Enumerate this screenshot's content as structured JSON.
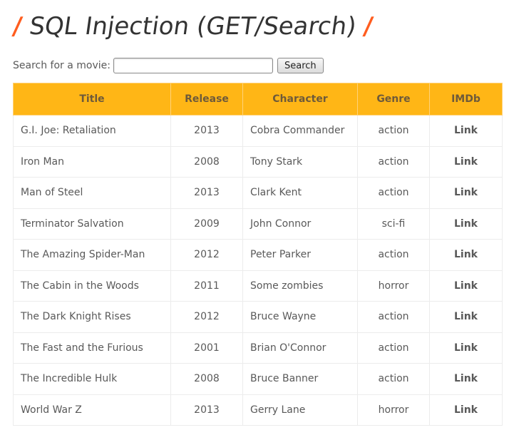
{
  "header": {
    "slash_left": "/",
    "title": "SQL Injection (GET/Search)",
    "slash_right": "/"
  },
  "search": {
    "label": "Search for a movie:",
    "value": "",
    "placeholder": "",
    "button_label": "Search"
  },
  "table": {
    "columns": [
      "Title",
      "Release",
      "Character",
      "Genre",
      "IMDb"
    ],
    "rows": [
      {
        "title": "G.I. Joe: Retaliation",
        "release": "2013",
        "character": "Cobra Commander",
        "genre": "action",
        "imdb": "Link"
      },
      {
        "title": "Iron Man",
        "release": "2008",
        "character": "Tony Stark",
        "genre": "action",
        "imdb": "Link"
      },
      {
        "title": "Man of Steel",
        "release": "2013",
        "character": "Clark Kent",
        "genre": "action",
        "imdb": "Link"
      },
      {
        "title": "Terminator Salvation",
        "release": "2009",
        "character": "John Connor",
        "genre": "sci-fi",
        "imdb": "Link"
      },
      {
        "title": "The Amazing Spider-Man",
        "release": "2012",
        "character": "Peter Parker",
        "genre": "action",
        "imdb": "Link"
      },
      {
        "title": "The Cabin in the Woods",
        "release": "2011",
        "character": "Some zombies",
        "genre": "horror",
        "imdb": "Link"
      },
      {
        "title": "The Dark Knight Rises",
        "release": "2012",
        "character": "Bruce Wayne",
        "genre": "action",
        "imdb": "Link"
      },
      {
        "title": "The Fast and the Furious",
        "release": "2001",
        "character": "Brian O'Connor",
        "genre": "action",
        "imdb": "Link"
      },
      {
        "title": "The Incredible Hulk",
        "release": "2008",
        "character": "Bruce Banner",
        "genre": "action",
        "imdb": "Link"
      },
      {
        "title": "World War Z",
        "release": "2013",
        "character": "Gerry Lane",
        "genre": "horror",
        "imdb": "Link"
      }
    ]
  },
  "colors": {
    "accent_slash": "#ff5d1f",
    "header_background": "#ffb616"
  }
}
